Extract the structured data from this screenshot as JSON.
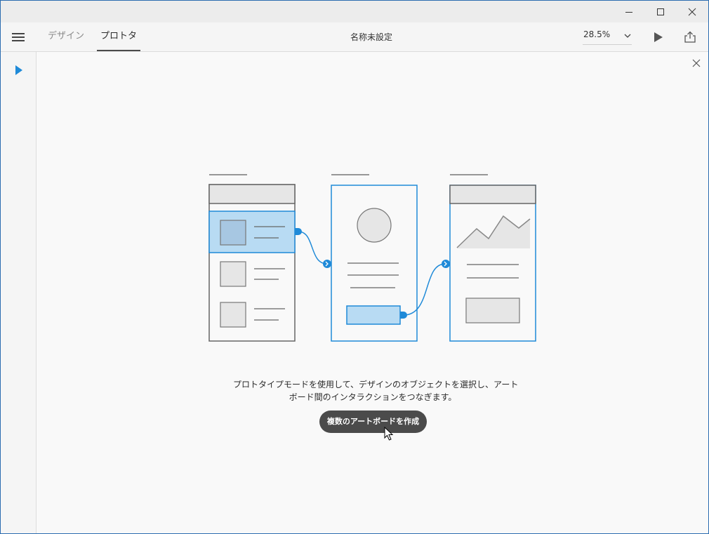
{
  "toolbar": {
    "tabs": [
      {
        "label": "デザイン",
        "active": false
      },
      {
        "label": "プロトタイプ",
        "active": true
      }
    ],
    "document_title": "名称未設定",
    "zoom": "28.5%"
  },
  "canvas": {
    "message_line1": "プロトタイプモードを使用して、デザインのオブジェクトを選択し、アート",
    "message_line2": "ボード間のインタラクションをつなぎます。",
    "create_button_label": "複数のアートボードを作成"
  },
  "colors": {
    "accent": "#1f8ad8",
    "highlight": "#b8dbf3",
    "button": "#4b4b4b",
    "titlebar": "#ececec",
    "toolbar": "#f5f5f5",
    "canvas": "#f9f9f9"
  },
  "icons": {
    "hamburger": "menu-icon",
    "play": "play-icon",
    "share": "share-icon",
    "select_tool": "select-arrow-icon",
    "close": "close-icon"
  }
}
